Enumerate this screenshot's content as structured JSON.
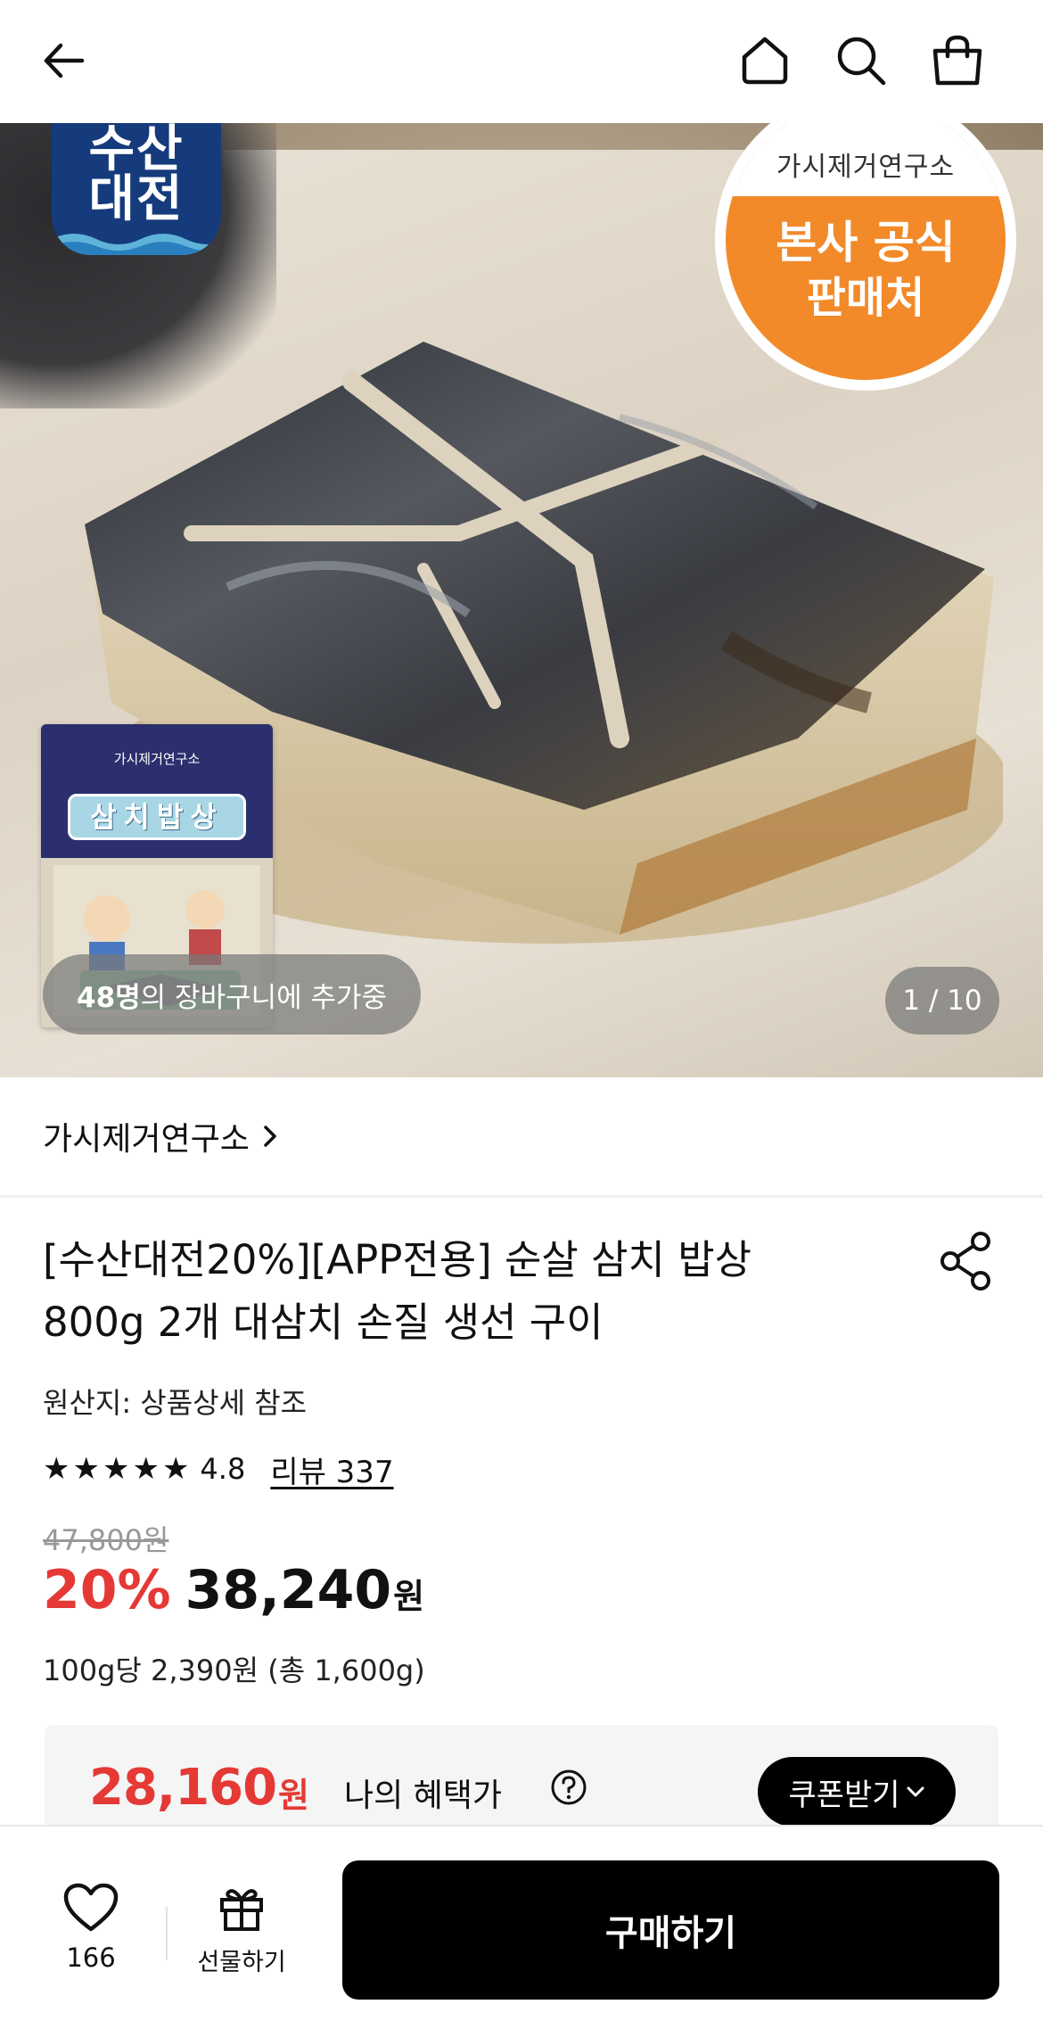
{
  "nav": {
    "back": "back-arrow-icon",
    "home": "home-icon",
    "search": "search-icon",
    "cart": "shopping-bag-icon"
  },
  "hero": {
    "sale_badge": [
      "수산",
      "대전"
    ],
    "official_badge": {
      "top": "가시제거연구소",
      "line1": "본사 공식",
      "line2": "판매처"
    },
    "package": {
      "brand": "가시제거연구소",
      "title": "삼치밥상"
    },
    "cart_count_bold": "48명",
    "cart_count_text": "의 장바구니에 추가중",
    "image_counter": "1 / 10"
  },
  "store": {
    "name": "가시제거연구소",
    "chevron": "chevron-right-icon"
  },
  "product": {
    "title": "[수산대전20%][APP전용] 순살 삼치 밥상 800g 2개 대삼치 손질 생선 구이",
    "origin": "원산지: 상품상세 참조",
    "rating_value": 4.8,
    "rating_score": "4.8",
    "review_link": "리뷰 337",
    "original_price": "47,800원",
    "discount": "20%",
    "price": "38,240",
    "price_unit": "원",
    "unit_price": "100g당 2,390원 (총 1,600g)"
  },
  "benefit": {
    "amount": "28,160",
    "unit": "원",
    "label": "나의 혜택가",
    "coupon_button": "쿠폰받기"
  },
  "bottom": {
    "like_count": "166",
    "gift_label": "선물하기",
    "buy_label": "구매하기"
  },
  "colors": {
    "accent_red": "#e53935",
    "button_black": "#000000",
    "official_orange": "#f28a2a",
    "sale_blue": "#153b7c"
  }
}
